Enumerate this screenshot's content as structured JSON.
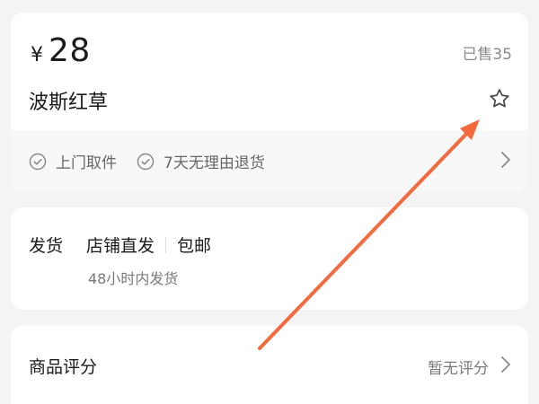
{
  "product": {
    "currency": "¥",
    "price": "28",
    "sold": "已售35",
    "title": "波斯红草"
  },
  "favorite": {
    "icon": "star-outline-icon"
  },
  "services": {
    "items": [
      {
        "label": "上门取件",
        "icon": "check-circle-icon"
      },
      {
        "label": "7天无理由退货",
        "icon": "check-circle-icon"
      }
    ],
    "arrow_icon": "chevron-right-icon"
  },
  "shipping": {
    "label": "发货",
    "method": "店铺直发",
    "fee": "包邮",
    "note": "48小时内发货"
  },
  "rating": {
    "label": "商品评分",
    "value": "暂无评分",
    "arrow_icon": "chevron-right-icon"
  },
  "annotation": {
    "color": "#f26a3d",
    "points_to": "star-outline-icon"
  }
}
